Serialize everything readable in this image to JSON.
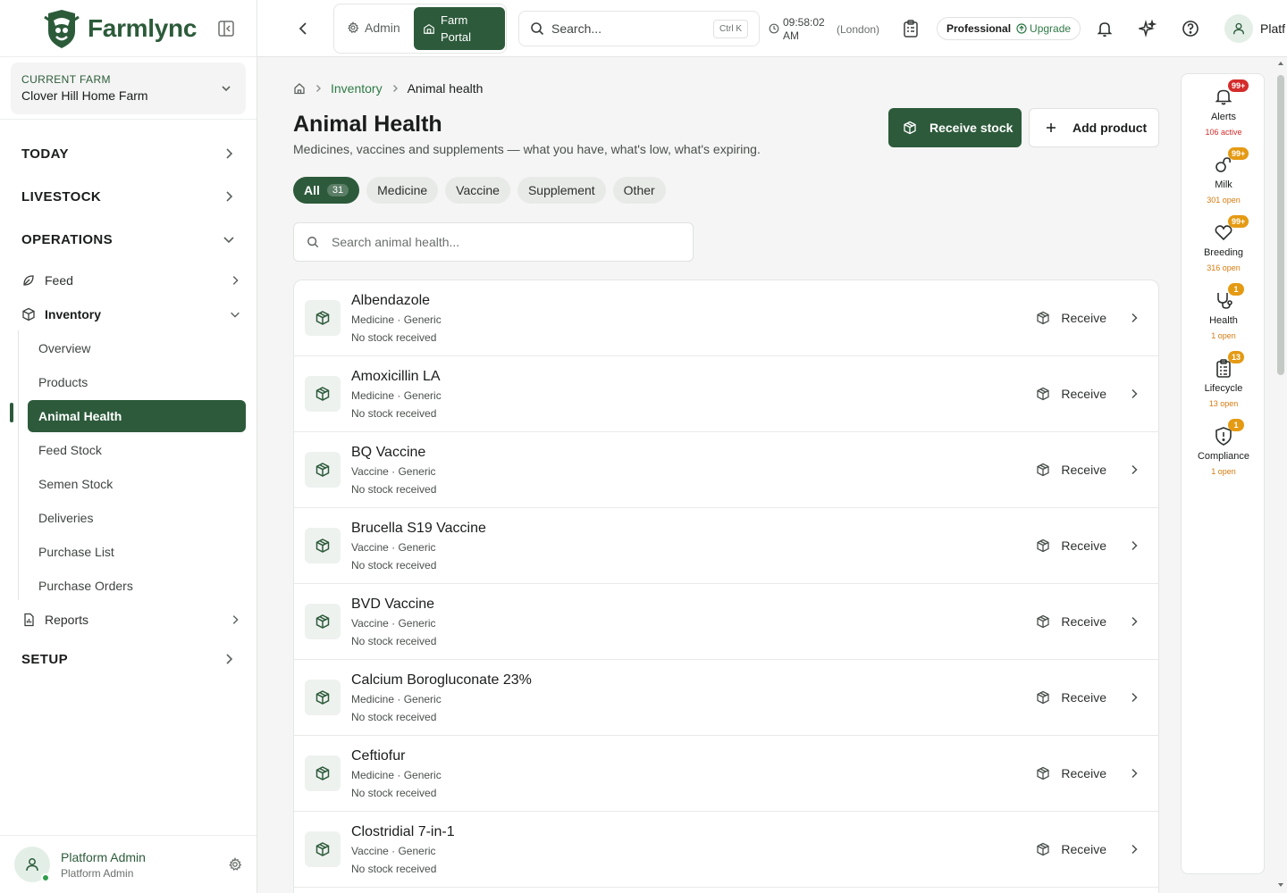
{
  "brand": {
    "name": "Farmlync"
  },
  "farm": {
    "label": "CURRENT FARM",
    "name": "Clover Hill Home Farm"
  },
  "nav": {
    "today": "TODAY",
    "livestock": "LIVESTOCK",
    "operations": "OPERATIONS",
    "feed": "Feed",
    "inventory": "Inventory",
    "sub": [
      "Overview",
      "Products",
      "Animal Health",
      "Feed Stock",
      "Semen Stock",
      "Deliveries",
      "Purchase List",
      "Purchase Orders"
    ],
    "reports": "Reports",
    "setup": "SETUP"
  },
  "user": {
    "name": "Platform Admin",
    "role": "Platform Admin",
    "short": "Platf"
  },
  "topbar": {
    "admin": "Admin",
    "farm_portal": "Farm Portal",
    "search_placeholder": "Search...",
    "shortcut": "Ctrl K",
    "time": "09:58:02 AM",
    "timezone": "(London)",
    "plan": "Professional",
    "upgrade": "Upgrade"
  },
  "breadcrumb": {
    "parent": "Inventory",
    "current": "Animal health"
  },
  "page": {
    "title": "Animal Health",
    "subtitle": "Medicines, vaccines and supplements — what you have, what's low, what's expiring.",
    "receive_stock": "Receive stock",
    "add_product": "Add product",
    "search_placeholder": "Search animal health..."
  },
  "filters": [
    {
      "label": "All",
      "count": "31",
      "active": true
    },
    {
      "label": "Medicine"
    },
    {
      "label": "Vaccine"
    },
    {
      "label": "Supplement"
    },
    {
      "label": "Other"
    }
  ],
  "products": [
    {
      "name": "Albendazole",
      "meta": "Medicine · Generic",
      "stock": "No stock received",
      "action": "Receive"
    },
    {
      "name": "Amoxicillin LA",
      "meta": "Medicine · Generic",
      "stock": "No stock received",
      "action": "Receive"
    },
    {
      "name": "BQ Vaccine",
      "meta": "Vaccine · Generic",
      "stock": "No stock received",
      "action": "Receive"
    },
    {
      "name": "Brucella S19 Vaccine",
      "meta": "Vaccine · Generic",
      "stock": "No stock received",
      "action": "Receive"
    },
    {
      "name": "BVD Vaccine",
      "meta": "Vaccine · Generic",
      "stock": "No stock received",
      "action": "Receive"
    },
    {
      "name": "Calcium Borogluconate 23%",
      "meta": "Medicine · Generic",
      "stock": "No stock received",
      "action": "Receive"
    },
    {
      "name": "Ceftiofur",
      "meta": "Medicine · Generic",
      "stock": "No stock received",
      "action": "Receive"
    },
    {
      "name": "Clostridial 7-in-1",
      "meta": "Vaccine · Generic",
      "stock": "No stock received",
      "action": "Receive"
    }
  ],
  "rail": [
    {
      "label": "Alerts",
      "badge": "99+",
      "sub": "106 active",
      "icon": "bell-icon",
      "badge_color": "#d42c2c",
      "sub_color": "#d42c2c"
    },
    {
      "label": "Milk",
      "badge": "99+",
      "sub": "301 open",
      "icon": "milk-icon",
      "badge_color": "#e59a14",
      "sub_color": "#d47b0f"
    },
    {
      "label": "Breeding",
      "badge": "99+",
      "sub": "316 open",
      "icon": "heart-icon",
      "badge_color": "#e59a14",
      "sub_color": "#d47b0f"
    },
    {
      "label": "Health",
      "badge": "1",
      "sub": "1 open",
      "icon": "stethoscope-icon",
      "badge_color": "#e59a14",
      "sub_color": "#d47b0f"
    },
    {
      "label": "Lifecycle",
      "badge": "13",
      "sub": "13 open",
      "icon": "clipboard-icon",
      "badge_color": "#e59a14",
      "sub_color": "#d47b0f"
    },
    {
      "label": "Compliance",
      "badge": "1",
      "sub": "1 open",
      "icon": "shield-icon",
      "badge_color": "#e59a14",
      "sub_color": "#d47b0f"
    }
  ],
  "colors": {
    "brand": "#2d5a3b",
    "alert": "#d42c2c",
    "warning": "#e59a14"
  }
}
